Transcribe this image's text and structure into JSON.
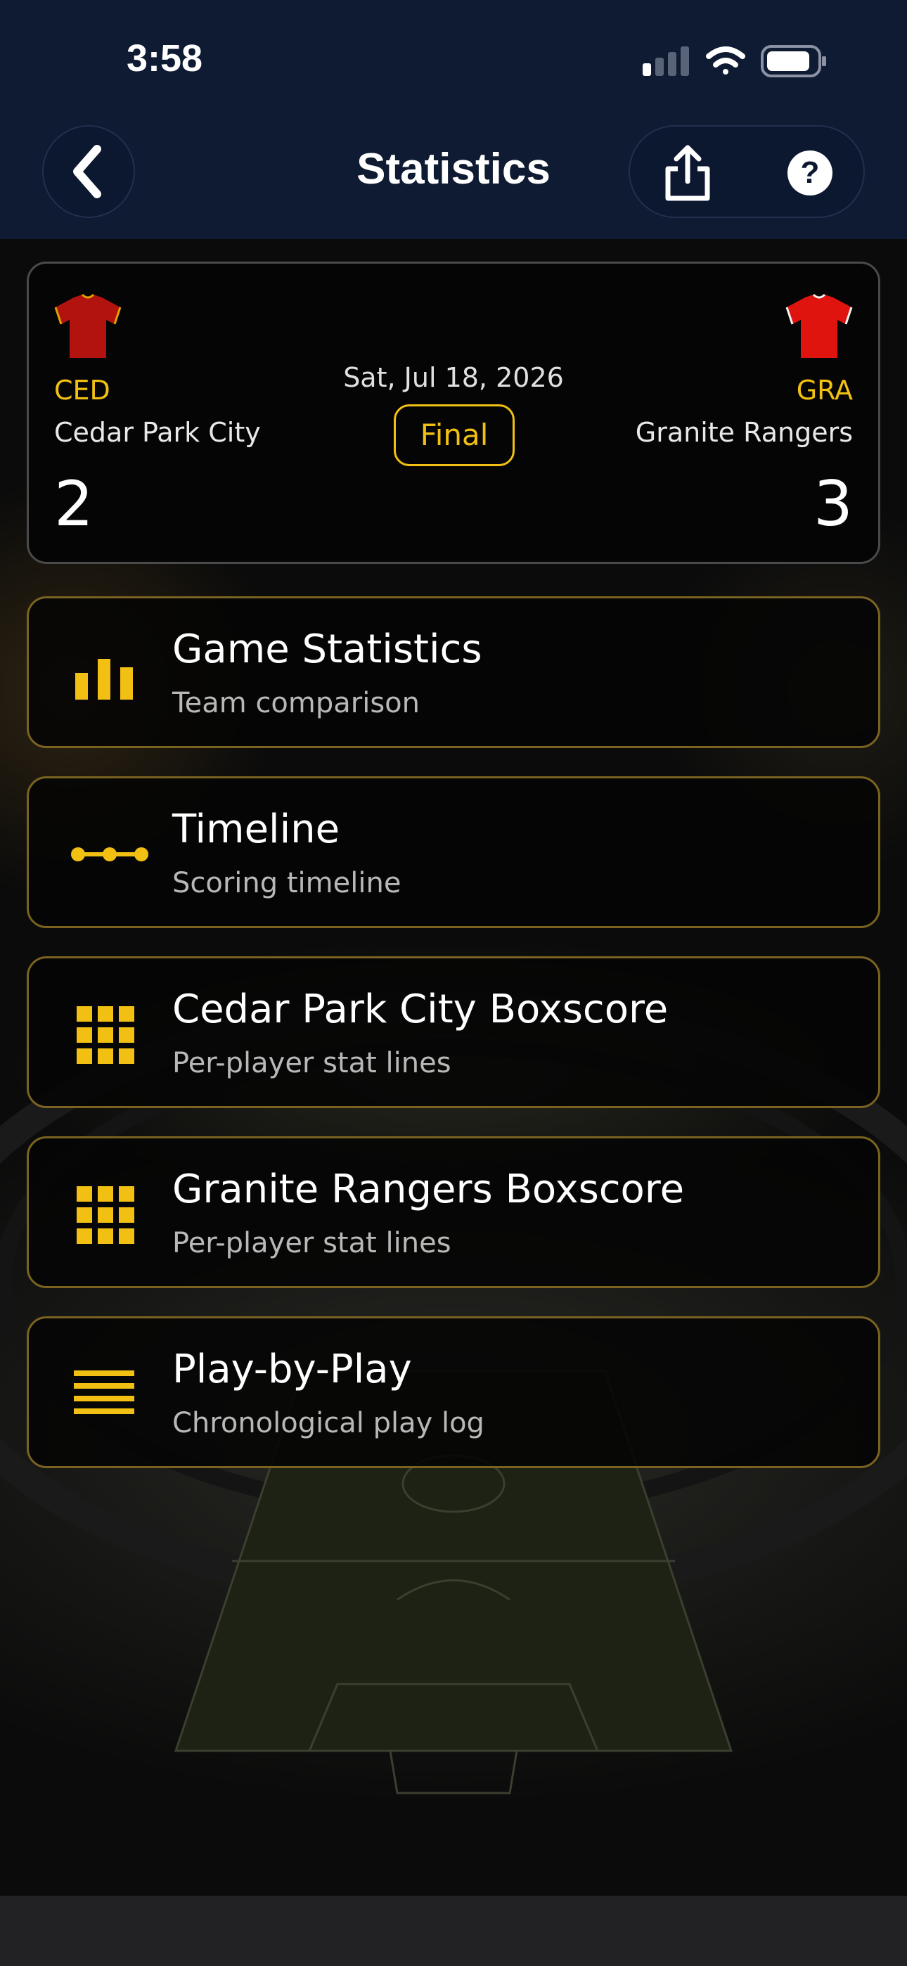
{
  "status_bar": {
    "time": "3:58"
  },
  "header": {
    "title": "Statistics"
  },
  "icons": {
    "back": "chevron-left-icon",
    "share": "share-icon",
    "help": "help-icon",
    "help_glyph": "?"
  },
  "match": {
    "date": "Sat, Jul 18, 2026",
    "status": "Final",
    "home": {
      "abbr": "CED",
      "name": "Cedar Park City",
      "score": "2",
      "jersey_color": "#b3130f"
    },
    "away": {
      "abbr": "GRA",
      "name": "Granite Rangers",
      "score": "3",
      "jersey_color": "#e0140f"
    }
  },
  "menu": [
    {
      "label": "Game Statistics",
      "subtitle": "Team comparison",
      "icon": "bar-chart-icon"
    },
    {
      "label": "Timeline",
      "subtitle": "Scoring timeline",
      "icon": "timeline-icon"
    },
    {
      "label": "Cedar Park City Boxscore",
      "subtitle": "Per-player stat lines",
      "icon": "grid-icon"
    },
    {
      "label": "Granite Rangers Boxscore",
      "subtitle": "Per-player stat lines",
      "icon": "grid-icon"
    },
    {
      "label": "Play-by-Play",
      "subtitle": "Chronological play log",
      "icon": "list-icon"
    }
  ],
  "colors": {
    "accent": "#f2c012",
    "header_bg": "#0f1a33",
    "card_border": "#7a6320"
  }
}
